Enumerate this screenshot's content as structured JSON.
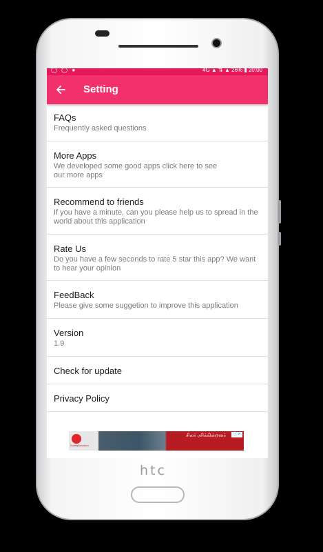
{
  "statusbar": {
    "left_icons": "◯ ◯ ●",
    "right_text": "4G ▲ ⇅ ▲ 26% ▮ 20:00"
  },
  "appbar": {
    "back_icon": "arrow-back-icon",
    "title": "Setting",
    "color": "#f2306b"
  },
  "items": [
    {
      "title": "FAQs",
      "subtitle": "Frequently asked questions"
    },
    {
      "title": "More Apps",
      "subtitle": "We developed some good apps click here to see our more apps"
    },
    {
      "title": "Recommend to friends",
      "subtitle": "If you have a minute, can you please help us to spread in the world about this application"
    },
    {
      "title": "Rate Us",
      "subtitle": "Do you have a few seconds to rate 5 star this app? We want to hear your opinion"
    },
    {
      "title": "FeedBack",
      "subtitle": "Please give some suggetion to improve this application"
    },
    {
      "title": "Version",
      "subtitle": "1.9"
    },
    {
      "title": "Check for update",
      "subtitle": ""
    },
    {
      "title": "Privacy Policy",
      "subtitle": ""
    }
  ],
  "ad": {
    "logo_text": "SurelyDecision",
    "text": "சிலர் ரசிக்கின்றனர்",
    "choice_icon": "ad-choices-icon"
  },
  "device": {
    "brand": "htc"
  }
}
